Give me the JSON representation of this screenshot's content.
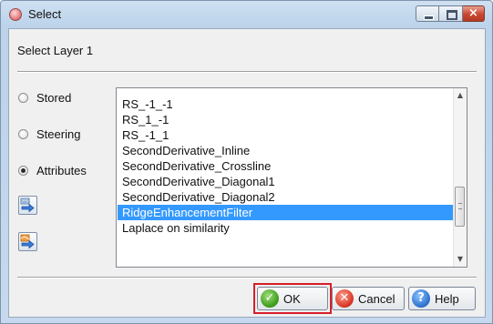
{
  "window": {
    "title": "Select",
    "controls": {
      "minimize": "minimize",
      "maximize": "maximize",
      "close": "×"
    }
  },
  "dialog": {
    "subtitle": "Select Layer 1",
    "sources": [
      {
        "label": "Stored",
        "checked": false
      },
      {
        "label": "Steering",
        "checked": false
      },
      {
        "label": "Attributes",
        "checked": true
      }
    ],
    "tool_buttons": [
      {
        "icon": "seg-arrow-import-icon"
      },
      {
        "icon": "layer-arrow-import-icon"
      }
    ],
    "list": {
      "items": [
        "RS_-1_-1",
        "RS_1_-1",
        "RS_-1_1",
        "SecondDerivative_Inline",
        "SecondDerivative_Crossline",
        "SecondDerivative_Diagonal1",
        "SecondDerivative_Diagonal2",
        "RidgeEnhancementFilter",
        "Laplace on similarity"
      ],
      "selected_index": 7
    },
    "scrollbar": {
      "up": "▲",
      "down": "▼"
    },
    "buttons": {
      "ok": {
        "label": "OK",
        "icon": "check-icon",
        "glyph": "✓"
      },
      "cancel": {
        "label": "Cancel",
        "icon": "x-icon",
        "glyph": "✕"
      },
      "help": {
        "label": "Help",
        "icon": "question-icon",
        "glyph": "?"
      }
    },
    "colors": {
      "selection": "#3399ff",
      "focus_highlight": "#d61f2a"
    }
  }
}
